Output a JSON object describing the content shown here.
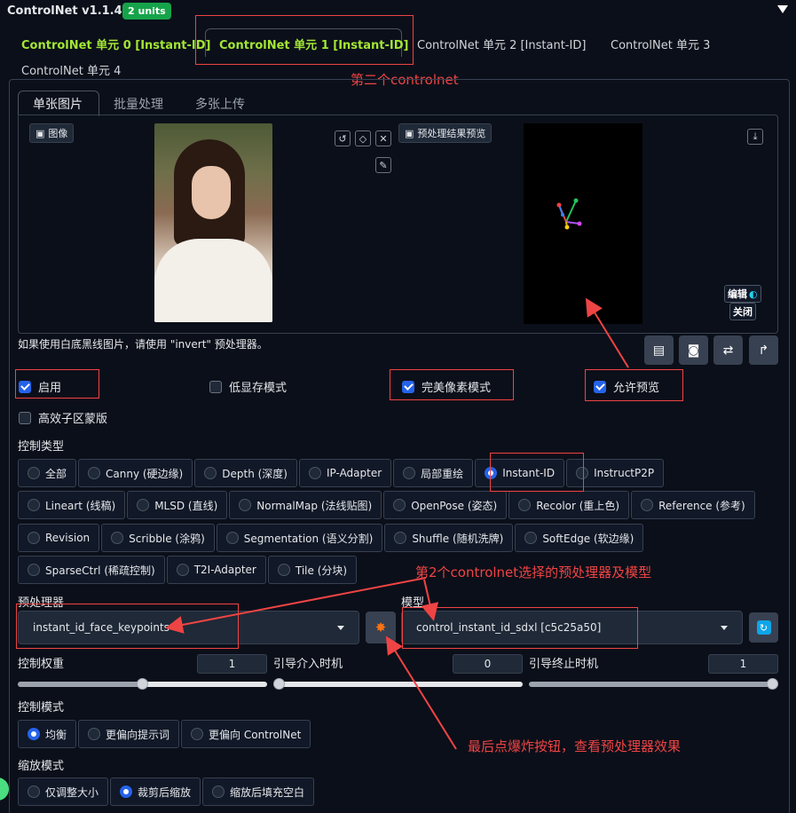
{
  "header": {
    "title": "ControlNet v1.1.455",
    "units_badge": "2 units"
  },
  "unit_tabs": [
    {
      "label": "ControlNet 单元 0 [Instant-ID]",
      "active": false,
      "highlight": true
    },
    {
      "label": "ControlNet 单元 1 [Instant-ID]",
      "active": true,
      "highlight": true
    },
    {
      "label": "ControlNet 单元 2 [Instant-ID]",
      "active": false,
      "highlight": false
    },
    {
      "label": "ControlNet 单元 3",
      "active": false,
      "highlight": false
    },
    {
      "label": "ControlNet 单元 4",
      "active": false,
      "highlight": false
    }
  ],
  "annotations": {
    "second_controlnet": "第二个controlnet",
    "preprocessor_model": "第2个controlnet选择的预处理器及模型",
    "explode_button": "最后点爆炸按钮，查看预处理器效果"
  },
  "image_tabs": [
    "单张图片",
    "批量处理",
    "多张上传"
  ],
  "image_panel": {
    "image_label": "图像",
    "preview_label": "预处理结果预览",
    "edit_label": "编辑",
    "close_label": "关闭",
    "tool_icons": [
      "undo-icon",
      "erase-icon",
      "close-icon",
      "brush-icon"
    ]
  },
  "hint": "如果使用白底黑线图片，请使用 \"invert\" 预处理器。",
  "checkboxes": [
    {
      "label": "启用",
      "checked": true
    },
    {
      "label": "低显存模式",
      "checked": false
    },
    {
      "label": "完美像素模式",
      "checked": true
    },
    {
      "label": "允许预览",
      "checked": true
    },
    {
      "label": "高效子区蒙版",
      "checked": false
    }
  ],
  "control_type": {
    "label": "控制类型",
    "selected": "Instant-ID",
    "rows": [
      [
        "全部",
        "Canny (硬边缘)",
        "Depth (深度)",
        "IP-Adapter",
        "局部重绘",
        "Instant-ID",
        "InstructP2P"
      ],
      [
        "Lineart (线稿)",
        "MLSD (直线)",
        "NormalMap (法线贴图)",
        "OpenPose (姿态)",
        "Recolor (重上色)",
        "Reference (参考)"
      ],
      [
        "Revision",
        "Scribble (涂鸦)",
        "Segmentation (语义分割)",
        "Shuffle (随机洗牌)",
        "SoftEdge (软边缘)"
      ],
      [
        "SparseCtrl (稀疏控制)",
        "T2I-Adapter",
        "Tile (分块)"
      ]
    ]
  },
  "preprocessor": {
    "label": "预处理器",
    "value": "instant_id_face_keypoints"
  },
  "model": {
    "label": "模型",
    "value": "control_instant_id_sdxl [c5c25a50]"
  },
  "sliders": [
    {
      "label": "控制权重",
      "value": "1",
      "fraction": 0.5
    },
    {
      "label": "引导介入时机",
      "value": "0",
      "fraction": 0.0
    },
    {
      "label": "引导终止时机",
      "value": "1",
      "fraction": 1.0
    }
  ],
  "control_mode": {
    "label": "控制模式",
    "options": [
      "均衡",
      "更偏向提示词",
      "更偏向 ControlNet"
    ],
    "selected": "均衡"
  },
  "resize_mode": {
    "label": "缩放模式",
    "options": [
      "仅调整大小",
      "裁剪后缩放",
      "缩放后填充空白"
    ],
    "selected": "裁剪后缩放"
  },
  "colors": {
    "accent": "#2563eb",
    "active_tab": "#a3e635",
    "annotation": "#ef4444",
    "badge": "#16a34a"
  }
}
